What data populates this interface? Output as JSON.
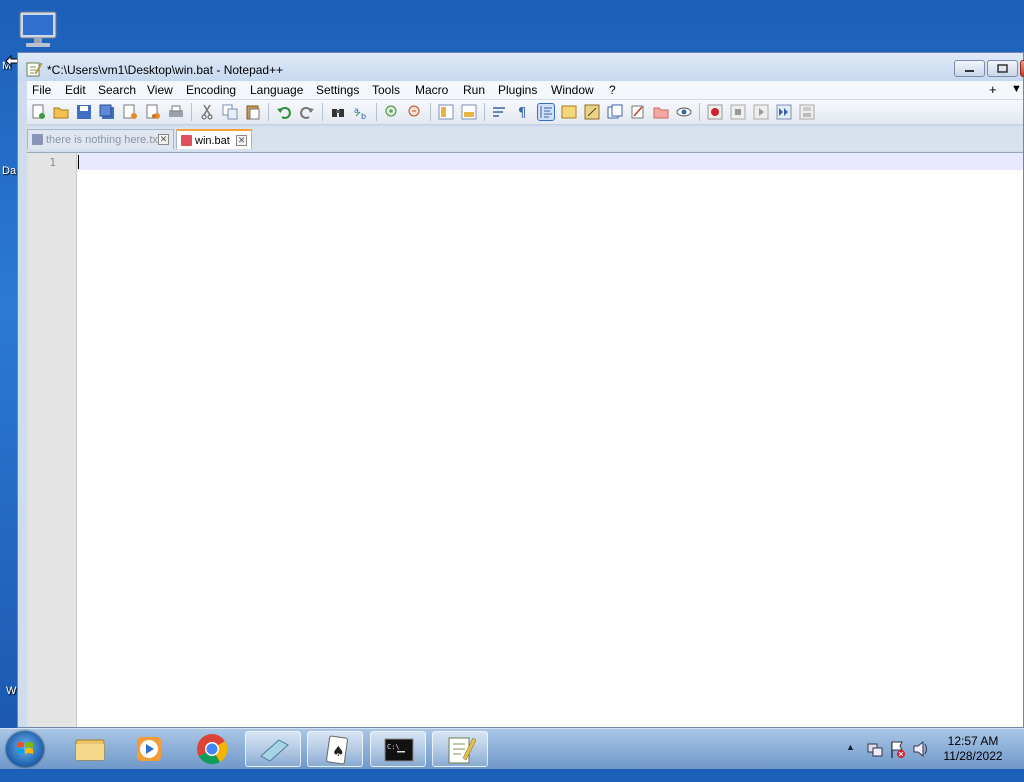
{
  "desktop": {
    "labels": [
      "M",
      "Da",
      "W"
    ]
  },
  "window": {
    "title": "*C:\\Users\\vm1\\Desktop\\win.bat - Notepad++"
  },
  "menu": [
    "File",
    "Edit",
    "Search",
    "View",
    "Encoding",
    "Language",
    "Settings",
    "Tools",
    "Macro",
    "Run",
    "Plugins",
    "Window",
    "?"
  ],
  "menu_extras": {
    "plus": "+",
    "dropdown": "▼"
  },
  "tabs": [
    {
      "label": "there is nothing here.txt",
      "close": "✕"
    },
    {
      "label": "win.bat",
      "close": "✕"
    }
  ],
  "editor": {
    "line_number": "1"
  },
  "taskbar": {
    "apps": [
      "Windows Explorer",
      "Windows Media Player",
      "Google Chrome",
      "Notepad",
      "Solitaire",
      "Command Prompt",
      "Notepad++"
    ],
    "time": "12:57 AM",
    "date": "11/28/2022",
    "show_hidden": "▲"
  },
  "colors": {
    "accent_tab": "#f6a33a",
    "current_line": "#e8e8ff",
    "taskbar": "#6f98c9"
  }
}
